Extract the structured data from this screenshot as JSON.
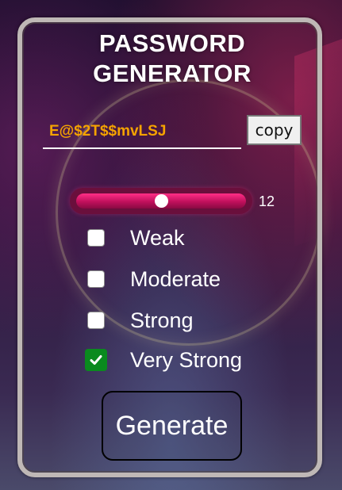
{
  "app": {
    "title_line1": "PASSWORD",
    "title_line2": "GENERATOR"
  },
  "password": {
    "value": "E@$2T$$mvLSJ",
    "copy_label": "copy"
  },
  "length": {
    "value": 12,
    "value_text": "12",
    "fill_fraction": 0.5
  },
  "options": [
    {
      "label": "Weak",
      "checked": false
    },
    {
      "label": "Moderate",
      "checked": false
    },
    {
      "label": "Strong",
      "checked": false
    },
    {
      "label": "Very Strong",
      "checked": true
    }
  ],
  "actions": {
    "generate_label": "Generate"
  },
  "colors": {
    "password_text": "#f5a300",
    "slider": "#e0126b",
    "checked": "#0a8a1e"
  }
}
